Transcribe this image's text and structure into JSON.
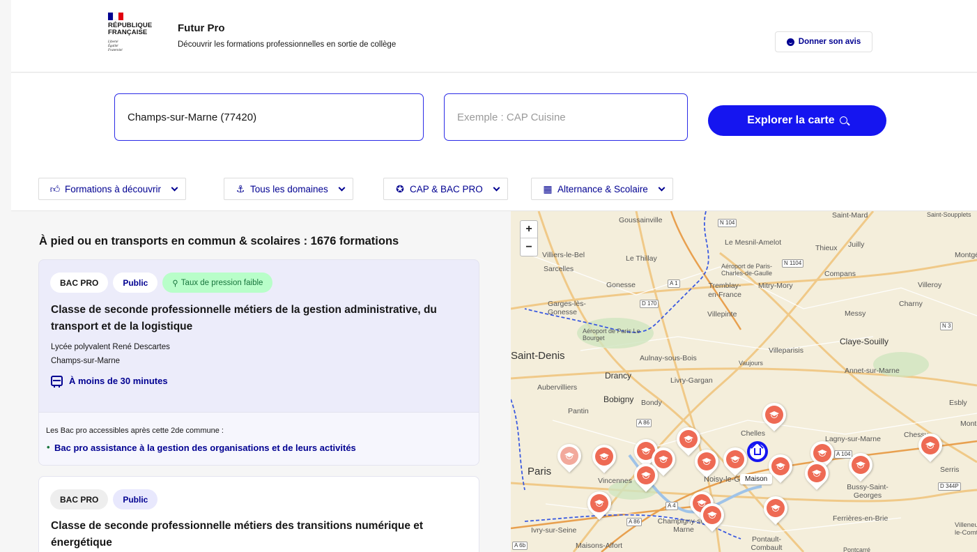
{
  "header": {
    "logo_line1": "RÉPUBLIQUE",
    "logo_line2": "FRANÇAISE",
    "motto1": "Liberté",
    "motto2": "Égalité",
    "motto3": "Fraternité",
    "title": "Futur Pro",
    "subtitle": "Découvrir les formations professionnelles en sortie de collège",
    "feedback_label": "Donner son avis",
    "flag_colors": [
      "#000091",
      "#ffffff",
      "#e1000f"
    ]
  },
  "search": {
    "location_value": "Champs-sur-Marne (77420)",
    "query_placeholder": "Exemple : CAP Cuisine",
    "button_label": "Explorer la carte"
  },
  "filters": [
    {
      "label": "Formations à découvrir",
      "icon": "thumb-up-icon"
    },
    {
      "label": "Tous les domaines",
      "icon": "anchor-icon"
    },
    {
      "label": "CAP & BAC PRO",
      "icon": "award-icon"
    },
    {
      "label": "Alternance & Scolaire",
      "icon": "building-icon"
    }
  ],
  "results": {
    "title": "À pied ou en transports en commun & scolaires : 1676 formations",
    "cards": [
      {
        "tags": [
          "BAC PRO",
          "Public",
          "Taux de pression faible"
        ],
        "title": "Classe de seconde professionnelle métiers de la gestion administrative, du transport et de la logistique",
        "school": "Lycée polyvalent René Descartes",
        "city": "Champs-sur-Marne",
        "transport": "À moins de 30 minutes",
        "followup_label": "Les Bac pro accessibles après cette 2de commune :",
        "followup_link": "Bac pro assistance à la gestion des organisations et de leurs activités"
      },
      {
        "tags": [
          "BAC PRO",
          "Public"
        ],
        "title": "Classe de seconde professionnelle métiers des transitions numérique et énergétique"
      }
    ]
  },
  "map": {
    "zoom_in": "+",
    "zoom_out": "−",
    "home_label": "Maison",
    "places": [
      "Goussainville",
      "Saint-Mard",
      "Saint-Soupplets",
      "Le Mesnil-Amelot",
      "Thieux",
      "Juilly",
      "Villiers-le-Bel",
      "Le Thillay",
      "Aéroport de Paris-Charles-de-Gaulle",
      "Sarcelles",
      "Compans",
      "Montgé",
      "Gonesse",
      "Tremblay-en-France",
      "Mitry-Mory",
      "Villeroy",
      "Garges-lès-Gonesse",
      "Charny",
      "Messy",
      "Villepinte",
      "Aéroport de Paris Le Bourget",
      "Claye-Souilly",
      "Villeparisis",
      "Saint-Denis",
      "Aulnay-sous-Bois",
      "Vaujours",
      "Annet-sur-Marne",
      "Drancy",
      "Livry-Gargan",
      "Aubervilliers",
      "Bobigny",
      "Bondy",
      "Esbly",
      "Pantin",
      "Montévrain",
      "Lagny-sur-Marne",
      "Chelles",
      "Paris",
      "Vincennes",
      "Noisy-le-Grand",
      "Serris",
      "Bussy-Saint-Georges",
      "Champigny-sur-Marne",
      "Ferrières-en-Brie",
      "Ivry-sur-Seine",
      "Villeneuve-le-Comte",
      "Maisons-Alfort",
      "Pontault-Combault",
      "Pontcarré",
      "Chessy"
    ],
    "roads": [
      "N 104",
      "N 1104",
      "A 1",
      "D 170",
      "N 3",
      "A 86",
      "A 104",
      "A 4",
      "D 344P",
      "A 6b",
      "A 86"
    ]
  }
}
